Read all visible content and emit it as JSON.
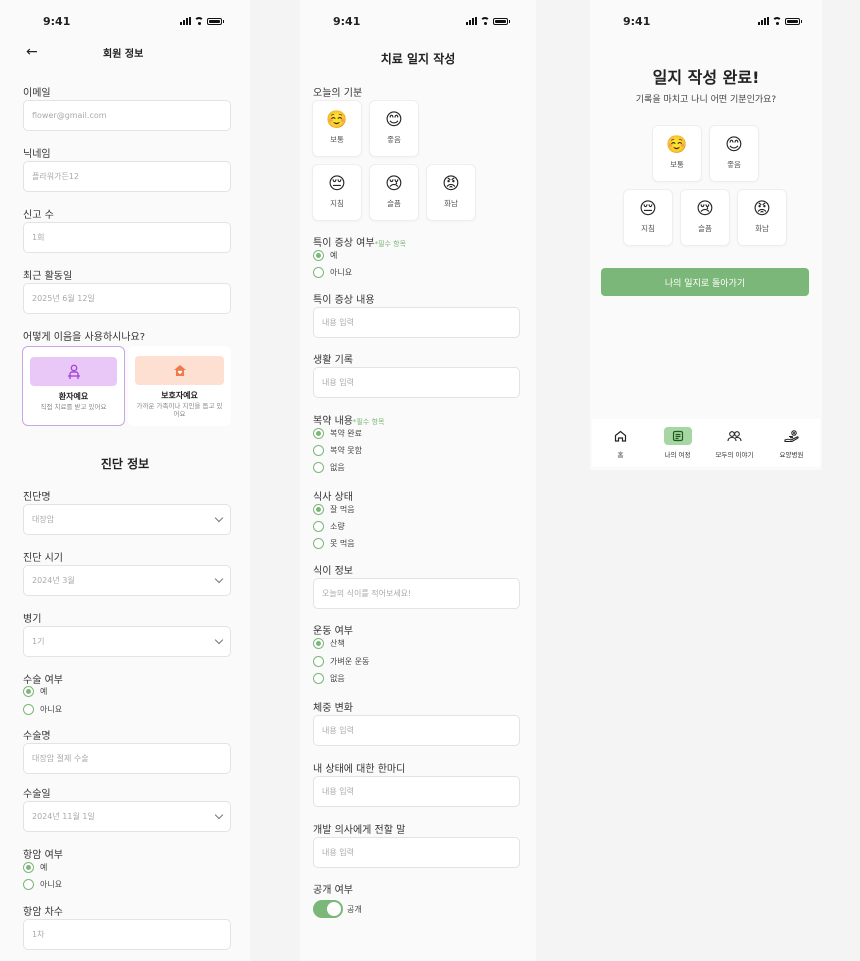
{
  "status_time": "9:41",
  "profile": {
    "header_title": "회원 정보",
    "email_label": "이메일",
    "email_value": "flower@gmail.com",
    "nickname_label": "닉네임",
    "nickname_value": "플라워가든12",
    "reports_label": "신고 수",
    "reports_value": "1회",
    "last_active_label": "최근 활동일",
    "last_active_value": "2025년 6월 12일",
    "usage_question": "어떻게 이음을 사용하시나요?",
    "patient_card": {
      "name": "환자예요",
      "desc": "직접 치료를 받고 있어요"
    },
    "guardian_card": {
      "name": "보호자예요",
      "desc": "가까운 가족이나 지인을 돕고 있어요"
    },
    "diagnosis_title": "진단 정보",
    "diag_name_label": "진단명",
    "diag_name_value": "대장암",
    "diag_time_label": "진단 시기",
    "diag_time_value": "2024년 3월",
    "stage_label": "병기",
    "stage_value": "1기",
    "surgery_label": "수술 여부",
    "surgery_yes": "예",
    "surgery_no": "아니요",
    "surgery_name_label": "수술명",
    "surgery_name_value": "대장암 절제 수술",
    "surgery_date_label": "수술일",
    "surgery_date_value": "2024년 11월 1일",
    "chemo_label": "항암 여부",
    "chemo_yes": "예",
    "chemo_no": "아니요",
    "chemo_round_label": "항암 차수",
    "chemo_round_value": "1차"
  },
  "journal": {
    "title": "치료 일지 작성",
    "mood_label": "오늘의 기분",
    "moods": [
      {
        "emoji": "☺️",
        "label": "보통"
      },
      {
        "emoji": "😊",
        "label": "좋음"
      },
      {
        "emoji": "😔",
        "label": "지침"
      },
      {
        "emoji": "😢",
        "label": "슬픔"
      },
      {
        "emoji": "😡",
        "label": "화남"
      }
    ],
    "symptom_label": "특이 증상 여부",
    "required_mark": "*필수 항목",
    "symptom_yes": "예",
    "symptom_no": "아니요",
    "symptom_detail_label": "특이 증상 내용",
    "input_placeholder": "내용 입력",
    "life_label": "생활 기록",
    "med_label": "복약 내용",
    "med_options": [
      "복약 완료",
      "복약 못함",
      "없음"
    ],
    "meal_label": "식사 상태",
    "meal_options": [
      "잘 먹음",
      "소량",
      "못 먹음"
    ],
    "diet_label": "식이 정보",
    "diet_placeholder": "오늘의 식이를 적어보세요!",
    "exercise_label": "운동 여부",
    "exercise_options": [
      "산책",
      "가벼운 운동",
      "없음"
    ],
    "weight_label": "체중 변화",
    "self_label": "내 상태에 대한 한마디",
    "doctor_label": "개발 의사에게 전할 말",
    "public_label": "공개 여부",
    "public_toggle_label": "공개"
  },
  "complete": {
    "title": "일지 작성 완료!",
    "subtitle": "기록을 마치고 나니 어떤 기분인가요?",
    "button": "나의 일지로 돌아가기",
    "tabs": [
      {
        "icon": "home-icon",
        "label": "홈"
      },
      {
        "icon": "journal-icon",
        "label": "나의 여정"
      },
      {
        "icon": "community-icon",
        "label": "모두의 이야기"
      },
      {
        "icon": "hospital-icon",
        "label": "요양병원"
      }
    ]
  },
  "colors": {
    "accent_green": "#7cb77a",
    "patient_purple": "#e9c8f7",
    "guardian_peach": "#fde0d2"
  }
}
